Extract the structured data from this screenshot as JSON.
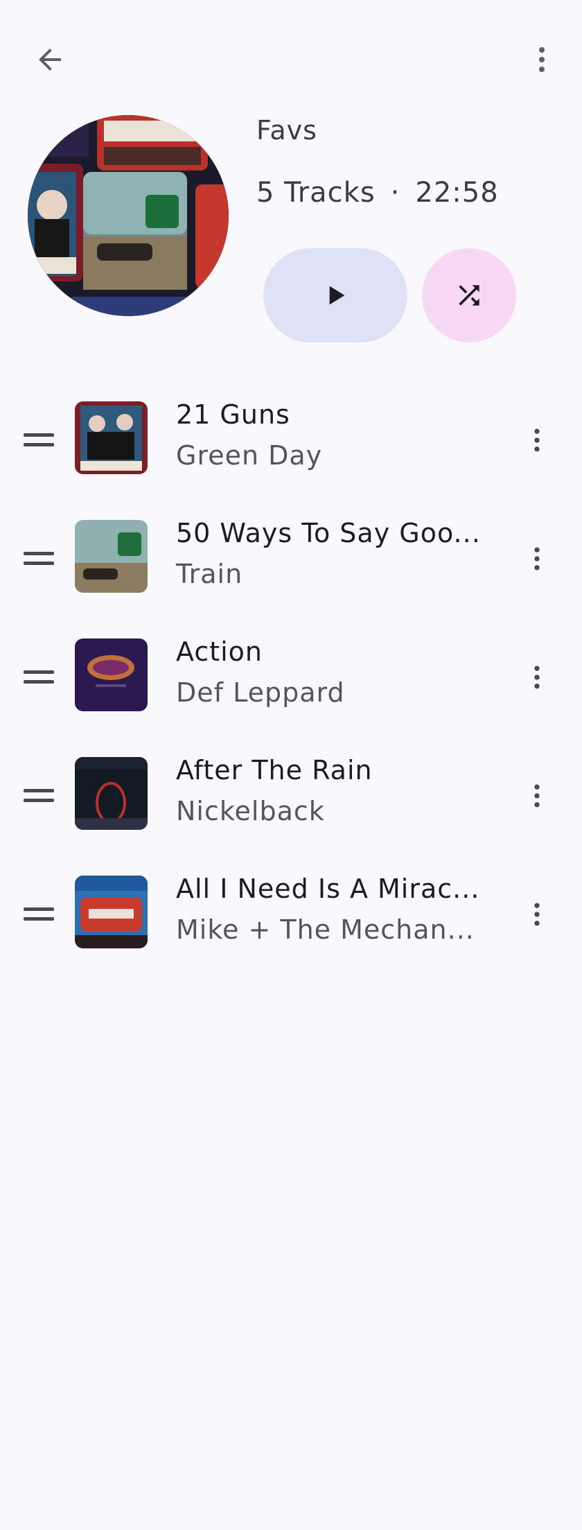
{
  "header": {
    "back_icon": "arrow-back-icon",
    "more_icon": "more-vert-icon"
  },
  "playlist": {
    "title": "Favs",
    "track_count": "5 Tracks",
    "separator": "·",
    "duration": "22:58",
    "play_icon": "play-icon",
    "shuffle_icon": "shuffle-icon",
    "colors": {
      "play_bg": "#dfe1f6",
      "shuffle_bg": "#f7d8f5"
    }
  },
  "tracks": [
    {
      "title": "21 Guns",
      "artist": "Green Day",
      "art": "green-day-art"
    },
    {
      "title": "50 Ways To Say Goo...",
      "artist": "Train",
      "art": "train-art"
    },
    {
      "title": "Action",
      "artist": "Def Leppard",
      "art": "def-leppard-art"
    },
    {
      "title": "After The Rain",
      "artist": "Nickelback",
      "art": "nickelback-art"
    },
    {
      "title": "All I Need Is A Mirac...",
      "artist": "Mike + The Mechan...",
      "art": "mike-mechanics-art"
    }
  ]
}
